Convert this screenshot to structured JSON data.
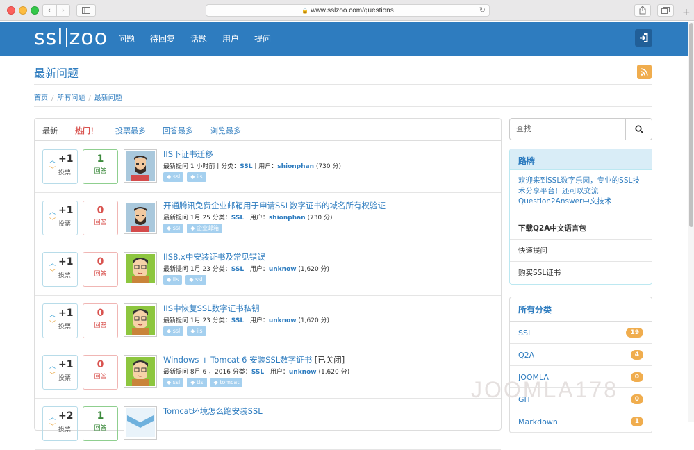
{
  "browser": {
    "url": "www.sslzoo.com/questions",
    "back_icon": "‹",
    "forward_icon": "›"
  },
  "header": {
    "logo_left": "ssl",
    "logo_right": "zoo",
    "nav": [
      "问题",
      "待回复",
      "话题",
      "用户",
      "提问"
    ]
  },
  "page": {
    "title": "最新问题",
    "breadcrumb": [
      "首页",
      "所有问题",
      "最新问题"
    ]
  },
  "tabs": [
    "最新",
    "热门！",
    "投票最多",
    "回答最多",
    "浏览最多"
  ],
  "questions": [
    {
      "votes": "+1",
      "vote_label": "投票",
      "answers": "1",
      "answer_label": "回答",
      "answered": true,
      "title": "IIS下证书迁移",
      "closed": "",
      "when": "最新提问 1 小时前 | 分类：",
      "category": "SSL",
      "user_prefix": " | 用户：",
      "user": "shionphan",
      "points": " (730 分)",
      "tags": [
        "ssl",
        "iis"
      ],
      "avatar": "beard"
    },
    {
      "votes": "+1",
      "vote_label": "投票",
      "answers": "0",
      "answer_label": "回答",
      "answered": false,
      "title": "开通腾讯免费企业邮箱用于申请SSL数字证书的域名所有权验证",
      "closed": "",
      "when": "最新提问 1月 25 分类：",
      "category": "SSL",
      "user_prefix": " | 用户：",
      "user": "shionphan",
      "points": " (730 分)",
      "tags": [
        "ssl",
        "企业邮箱"
      ],
      "avatar": "beard"
    },
    {
      "votes": "+1",
      "vote_label": "投票",
      "answers": "0",
      "answer_label": "回答",
      "answered": false,
      "title": "IIS8.x中安装证书及常见错误",
      "closed": "",
      "when": "最新提问 1月 23 分类：",
      "category": "SSL",
      "user_prefix": " | 用户：",
      "user": "unknow",
      "points": " (1,620 分)",
      "tags": [
        "iis",
        "ssl"
      ],
      "avatar": "glasses"
    },
    {
      "votes": "+1",
      "vote_label": "投票",
      "answers": "0",
      "answer_label": "回答",
      "answered": false,
      "title": "IIS中恢复SSL数字证书私钥",
      "closed": "",
      "when": "最新提问 1月 23 分类：",
      "category": "SSL",
      "user_prefix": " | 用户：",
      "user": "unknow",
      "points": " (1,620 分)",
      "tags": [
        "ssl",
        "iis"
      ],
      "avatar": "glasses"
    },
    {
      "votes": "+1",
      "vote_label": "投票",
      "answers": "0",
      "answer_label": "回答",
      "answered": false,
      "title": "Windows + Tomcat 6 安装SSL数字证书",
      "closed": " [已关闭]",
      "when": "最新提问 8月 6 ，2016 分类：",
      "category": "SSL",
      "user_prefix": " | 用户：",
      "user": "unknow",
      "points": " (1,620 分)",
      "tags": [
        "ssl",
        "tls",
        "tomcat"
      ],
      "avatar": "glasses"
    },
    {
      "votes": "+2",
      "vote_label": "投票",
      "answers": "1",
      "answer_label": "回答",
      "answered": true,
      "title": "Tomcat环境怎么跑安装SSL",
      "closed": "",
      "when": "",
      "category": "",
      "user_prefix": "",
      "user": "",
      "points": "",
      "tags": [],
      "avatar": "chevron"
    }
  ],
  "sidebar": {
    "search_placeholder": "查找",
    "guide_title": "路牌",
    "guide_intro": "欢迎来到SSL数字乐园，专业的SSL技术分享平台！还可以交流Question2Answer中文技术",
    "guide_links": [
      "下载Q2A中文语言包",
      "快速提问",
      "购买SSL证书"
    ],
    "categories_title": "所有分类",
    "categories": [
      {
        "name": "SSL",
        "count": "19"
      },
      {
        "name": "Q2A",
        "count": "4"
      },
      {
        "name": "JOOMLA",
        "count": "0"
      },
      {
        "name": "GIT",
        "count": "0"
      },
      {
        "name": "Markdown",
        "count": "1"
      }
    ]
  },
  "watermark": "JOOMLA178",
  "colors": {
    "brand": "#2e7cbf",
    "hot": "#d9534f",
    "badge": "#f0ad4e"
  }
}
